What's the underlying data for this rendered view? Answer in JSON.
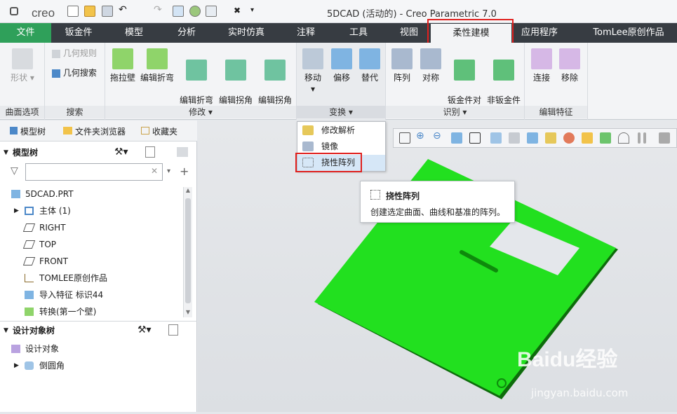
{
  "app": {
    "logo": "creo",
    "window_title": "5DCAD (活动的) - Creo Parametric 7.0"
  },
  "tabs": [
    {
      "label": "文件"
    },
    {
      "label": "钣金件"
    },
    {
      "label": "模型"
    },
    {
      "label": "分析"
    },
    {
      "label": "实时仿真"
    },
    {
      "label": "注释"
    },
    {
      "label": "工具"
    },
    {
      "label": "视图"
    },
    {
      "label": "柔性建模"
    },
    {
      "label": "应用程序"
    },
    {
      "label": "TomLee原创作品"
    }
  ],
  "ribbon": {
    "surface_options": {
      "button": "形状",
      "label": "曲面选项"
    },
    "search": {
      "geom_rule": "几何规则",
      "geom_search": "几何搜索",
      "label": "搜索"
    },
    "modify": {
      "buttons": [
        "拖拉壁",
        "编辑折弯",
        "编辑折弯\n止裂槽",
        "编辑拐角\n止裂槽",
        "编辑拐角\n接缝"
      ],
      "label": "修改"
    },
    "transform": {
      "buttons": [
        "移动",
        "偏移",
        "替代"
      ],
      "label": "变换"
    },
    "recognize": {
      "buttons": [
        "阵列",
        "对称",
        "钣金件对\n象",
        "非钣金件\n对象"
      ],
      "label": "识别"
    },
    "edit_feature": {
      "buttons": [
        "连接",
        "移除"
      ],
      "label": "编辑特征"
    }
  },
  "left_panel": {
    "tabs": [
      "模型树",
      "文件夹浏览器",
      "收藏夹"
    ],
    "model_tree_header": "模型树",
    "items": [
      {
        "label": "5DCAD.PRT"
      },
      {
        "label": "主体 (1)"
      },
      {
        "label": "RIGHT"
      },
      {
        "label": "TOP"
      },
      {
        "label": "FRONT"
      },
      {
        "label": "TOMLEE原创作品"
      },
      {
        "label": "导入特征 标识44"
      },
      {
        "label": "转换(第一个壁)"
      }
    ],
    "design_tree_header": "设计对象树",
    "design_items": [
      {
        "label": "设计对象"
      },
      {
        "label": "倒圆角"
      }
    ]
  },
  "dropdown": {
    "items": [
      "修改解析",
      "镜像",
      "挠性阵列"
    ]
  },
  "tooltip": {
    "title": "挠性阵列",
    "description": "创建选定曲面、曲线和基准的阵列。"
  },
  "watermark": {
    "brand": "Baidu经验",
    "url": "jingyan.baidu.com"
  },
  "colors": {
    "accent": "#2fa05a",
    "part_green": "#22e01f",
    "highlight_red": "#e0201e"
  }
}
